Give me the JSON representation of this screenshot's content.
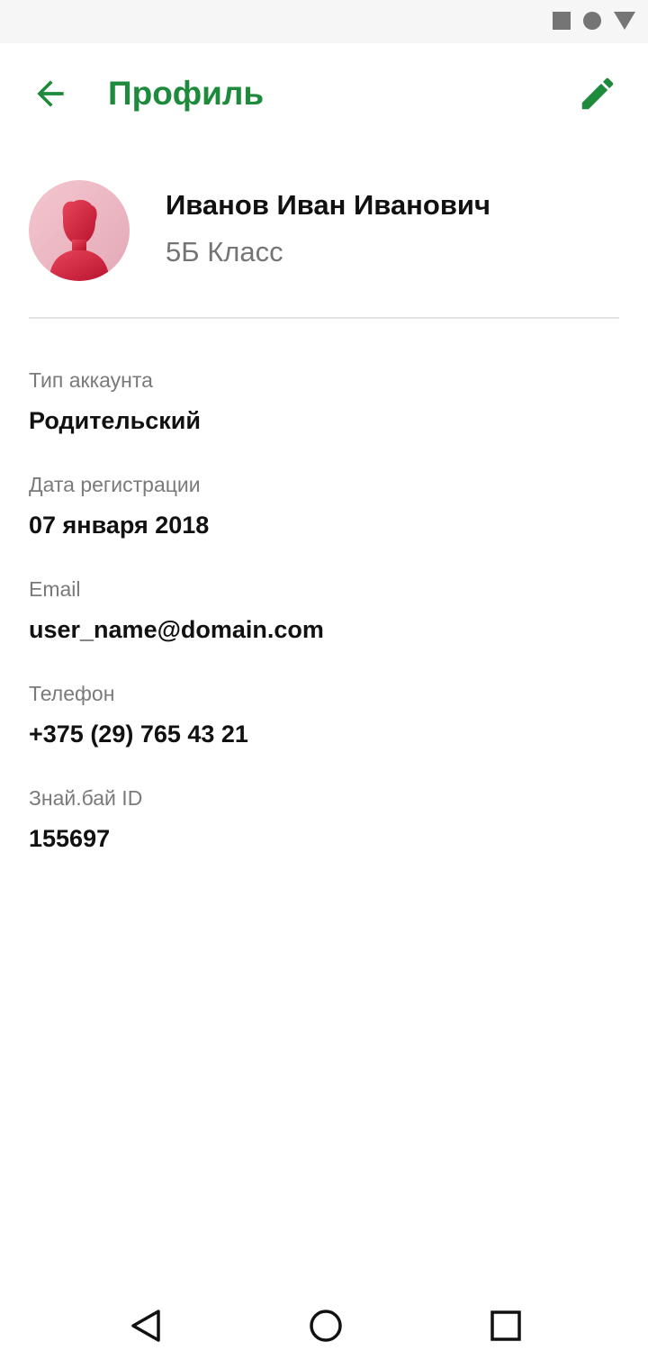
{
  "app_bar": {
    "title": "Профиль",
    "back_icon": "arrow-left-icon",
    "edit_icon": "pencil-icon"
  },
  "profile": {
    "name": "Иванов Иван Иванович",
    "class": "5Б Класс",
    "avatar_icon": "user-avatar-icon"
  },
  "fields": [
    {
      "label": "Тип аккаунта",
      "value": "Родительский"
    },
    {
      "label": "Дата регистрации",
      "value": "07 января 2018"
    },
    {
      "label": "Email",
      "value": "user_name@domain.com"
    },
    {
      "label": "Телефон",
      "value": "+375 (29) 765 43 21"
    },
    {
      "label": "Знай.бай ID",
      "value": "155697"
    }
  ],
  "colors": {
    "accent": "#1e8a3c",
    "avatar_bg": "#f2c4cc",
    "avatar_figure": "#d4233f"
  }
}
